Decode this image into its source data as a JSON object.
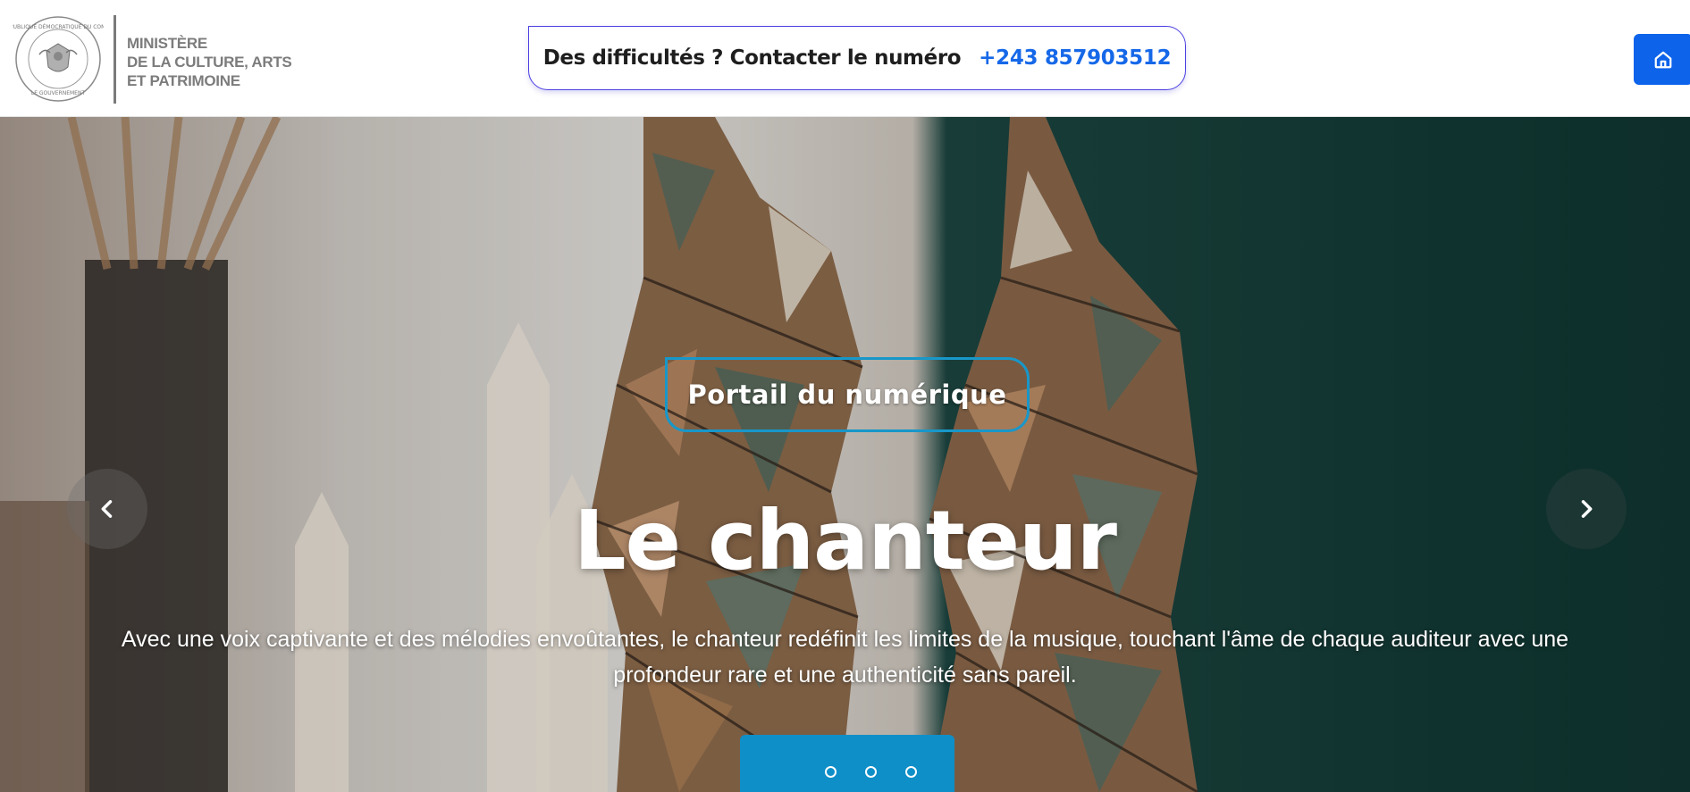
{
  "header": {
    "logo_alt": "RÉPUBLIQUE DÉMOCRATIQUE DU CONGO — LE GOUVERNEMENT",
    "seal_top_text": "RÉPUBLIQUE DÉMOCRATIQUE DU CONGO",
    "seal_bottom_text": "LE GOUVERNEMENT",
    "ministry_lines": [
      "MINISTÈRE",
      "DE LA CULTURE, ARTS",
      "ET PATRIMOINE"
    ],
    "contact_label": "Des difficultés ? Contacter le numéro",
    "contact_phone": "+243 857903512",
    "home_icon": "home-icon"
  },
  "hero": {
    "badge": "Portail du numérique",
    "title": "Le chanteur",
    "description": "Avec une voix captivante et des mélodies envoûtantes, le chanteur redéfinit les limites de la musique, touchant l'âme de chaque auditeur avec une profondeur rare et une authenticité sans pareil.",
    "prev_icon": "chevron-left-icon",
    "next_icon": "chevron-right-icon",
    "slide_count": 3
  },
  "colors": {
    "accent": "#0d63ea",
    "phone": "#1668e8",
    "badge_border": "#1897c9",
    "dots_panel": "#0f8fc8"
  }
}
